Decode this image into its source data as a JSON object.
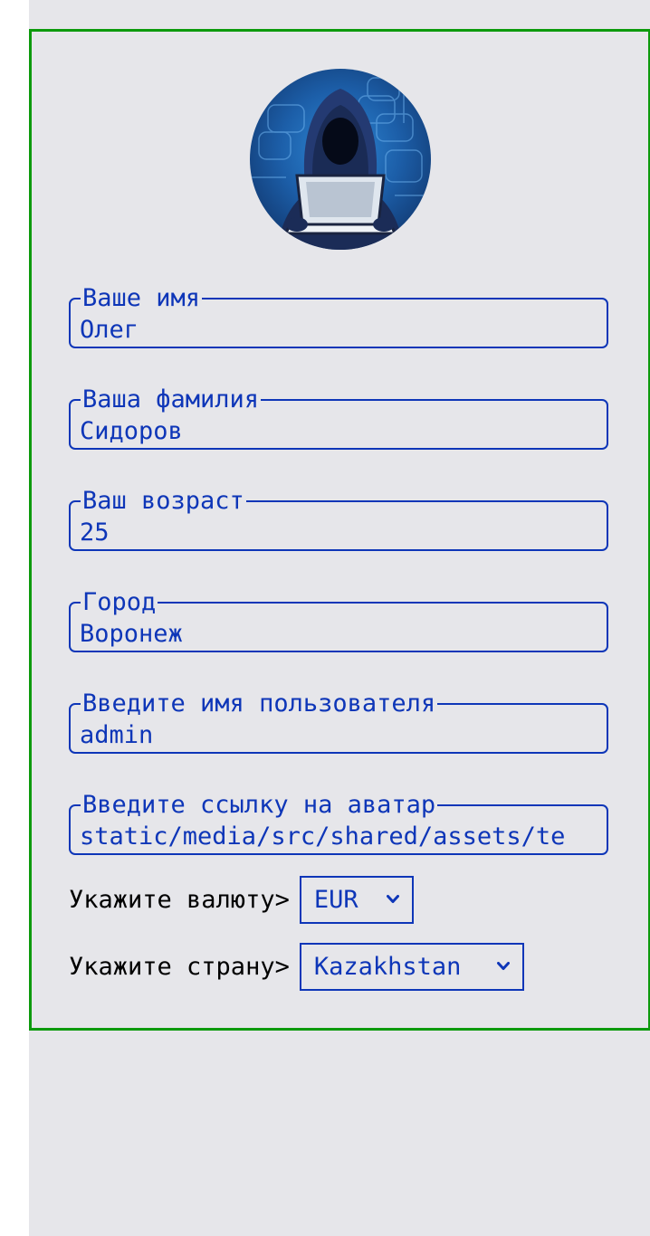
{
  "fields": [
    {
      "legend": "Ваше имя",
      "value": "Олег"
    },
    {
      "legend": "Ваша фамилия",
      "value": "Сидоров"
    },
    {
      "legend": "Ваш возраст",
      "value": "25"
    },
    {
      "legend": "Город",
      "value": "Воронеж"
    },
    {
      "legend": "Введите имя пользователя",
      "value": "admin"
    },
    {
      "legend": "Введите ссылку на аватар",
      "value": "static/media/src/shared/assets/te"
    }
  ],
  "currency": {
    "label": "Укажите валюту>",
    "selected": "EUR"
  },
  "country": {
    "label": "Укажите страну>",
    "selected": "Kazakhstan"
  },
  "avatar": {
    "icon": "hooded-hacker-avatar"
  },
  "colors": {
    "border_green": "#0d9a0d",
    "accent_blue": "#0e36b8",
    "background": "#e6e6ea"
  }
}
